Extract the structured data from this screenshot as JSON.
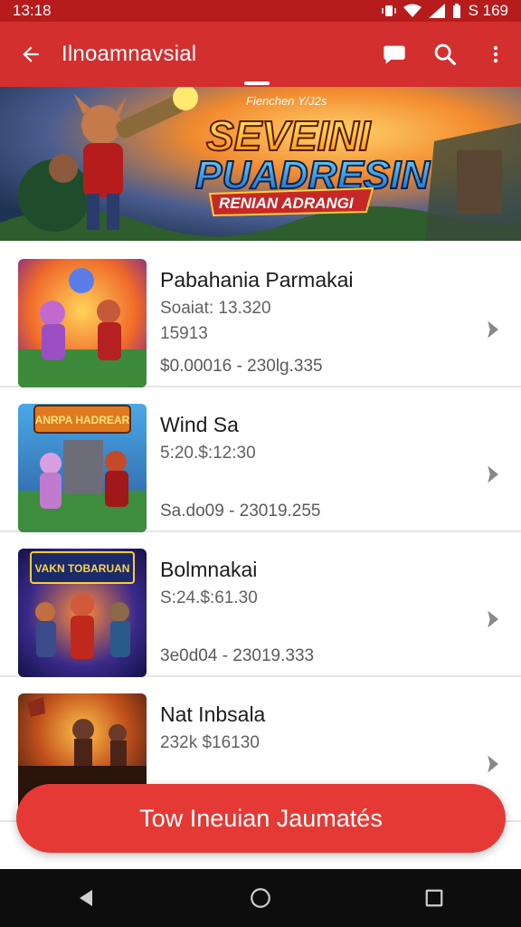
{
  "status_bar": {
    "time": "13:18",
    "battery": "S 169"
  },
  "app_bar": {
    "title": "Ilnoamnavsial"
  },
  "banner": {
    "kicker": "Fienchen Y/J2s",
    "line1": "SEVEINI",
    "line2": "PUADRESIN",
    "ribbon": "RENIAN ADRANGI"
  },
  "items": [
    {
      "name": "Pabahania Parmakai",
      "meta1": "Soaiat: 13.320",
      "meta2": "15913",
      "meta3": "$0.00016 - 230lg.335"
    },
    {
      "name": "Wind Sa",
      "meta1": "5:20.$:12:30",
      "meta2": "",
      "meta3": "Sa.do09 - 23019.255",
      "thumb_title": "ANRPA HADREAR"
    },
    {
      "name": "Bolmnakai",
      "meta1": "S:24.$:61.30",
      "meta2": "",
      "meta3": "3e0d04 - 23019.333",
      "thumb_title": "VAKN TOBARUAN"
    },
    {
      "name": "Nat Inbsala",
      "meta1": "232k $16130",
      "meta2": "",
      "meta3": ""
    }
  ],
  "cta": {
    "label": "Tow Ineuian Jaumatés"
  },
  "colors": {
    "primary": "#d32f2f",
    "status": "#b71c1c",
    "cta": "#e53935"
  },
  "icons": {
    "back": "arrow-left-icon",
    "chat": "chat-bubble-icon",
    "search": "search-icon",
    "more": "more-vert-icon",
    "row_chevron": "chevron-right-icon"
  }
}
